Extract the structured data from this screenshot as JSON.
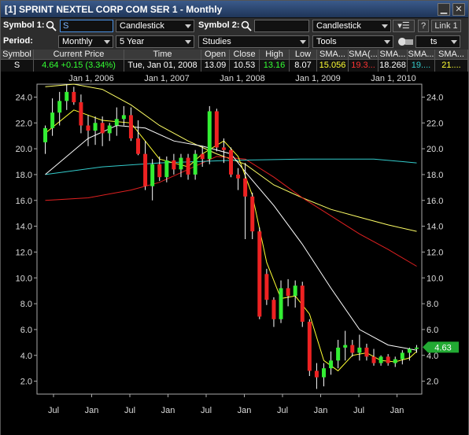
{
  "window": {
    "title": "[1] SPRINT NEXTEL CORP COM SER 1 - Monthly"
  },
  "toolbar": {
    "symbol1_label": "Symbol 1:",
    "symbol1_value": "S",
    "chart_type1": "Candlestick",
    "symbol2_label": "Symbol 2:",
    "symbol2_value": "",
    "chart_type2": "Candlestick",
    "help_label": "?",
    "link_label": "Link 1",
    "period_label": "Period:",
    "period_value": "Monthly",
    "range_value": "5 Year",
    "studies_value": "Studies",
    "tools_value": "Tools",
    "alerts_value": "ts"
  },
  "quote_table": {
    "headers": [
      "Symbol",
      "Current Price",
      "Time",
      "Open",
      "Close",
      "High",
      "Low",
      "SMA...",
      "SMA(...",
      "SMA...",
      "SMA...",
      "SMA..."
    ],
    "row": {
      "symbol": "S",
      "current_price": "4.64 +0.15 (3.34%)",
      "time": "Tue, Jan 01, 2008",
      "open": "13.09",
      "close": "10.53",
      "high": "13.16",
      "low": "8.07",
      "sma1": "15.056",
      "sma2": "19.3...",
      "sma3": "18.268",
      "sma4": "19....",
      "sma5": "21...."
    },
    "colors": {
      "price": "#33ff33",
      "high": "#33ff33",
      "sma1": "#ffff33",
      "sma2": "#ff3333",
      "sma3": "#ffffff",
      "sma4": "#33cccc",
      "sma5": "#ffff33"
    }
  },
  "chart_data": {
    "type": "candlestick",
    "title": "",
    "top_axis_labels": [
      "Jan 1, 2006",
      "Jan 1, 2007",
      "Jan 1, 2008",
      "Jan 1, 2009",
      "Jan 1, 2010"
    ],
    "bottom_axis_labels": [
      "Jul",
      "Jan",
      "Jul",
      "Jan",
      "Jul",
      "Jan",
      "Jul",
      "Jan",
      "Jul",
      "Jan"
    ],
    "y_ticks": [
      2.0,
      4.0,
      6.0,
      8.0,
      10.0,
      12.0,
      14.0,
      16.0,
      18.0,
      20.0,
      22.0,
      24.0
    ],
    "ylim": [
      1.0,
      25.0
    ],
    "current_price_label": "4.63",
    "candles": [
      [
        20.5,
        21.8,
        19.6,
        21.6
      ],
      [
        21.6,
        23.9,
        21.0,
        22.8
      ],
      [
        22.8,
        24.4,
        21.8,
        23.7
      ],
      [
        23.7,
        25.0,
        23.0,
        24.4
      ],
      [
        24.4,
        24.8,
        23.4,
        23.6
      ],
      [
        23.6,
        24.2,
        21.2,
        21.8
      ],
      [
        21.8,
        22.6,
        20.2,
        21.4
      ],
      [
        21.4,
        22.5,
        20.3,
        22.0
      ],
      [
        22.0,
        22.5,
        20.2,
        21.2
      ],
      [
        21.2,
        22.0,
        20.6,
        21.8
      ],
      [
        21.8,
        23.2,
        21.0,
        22.3
      ],
      [
        22.3,
        23.3,
        21.8,
        22.6
      ],
      [
        22.6,
        23.2,
        20.6,
        20.8
      ],
      [
        20.8,
        22.2,
        19.5,
        19.6
      ],
      [
        19.6,
        20.6,
        16.8,
        17.1
      ],
      [
        17.1,
        19.2,
        16.0,
        18.8
      ],
      [
        18.8,
        19.4,
        17.5,
        17.8
      ],
      [
        17.8,
        19.4,
        17.4,
        19.1
      ],
      [
        19.1,
        19.6,
        18.0,
        18.4
      ],
      [
        18.4,
        19.6,
        17.8,
        19.3
      ],
      [
        19.3,
        19.6,
        17.6,
        18.0
      ],
      [
        18.0,
        19.9,
        17.6,
        19.6
      ],
      [
        19.6,
        20.2,
        18.6,
        19.2
      ],
      [
        19.2,
        23.3,
        18.8,
        22.9
      ],
      [
        22.9,
        23.1,
        19.8,
        20.1
      ],
      [
        20.1,
        20.8,
        18.9,
        19.9
      ],
      [
        19.9,
        20.1,
        17.8,
        18.0
      ],
      [
        18.0,
        18.5,
        16.8,
        17.7
      ],
      [
        17.7,
        18.9,
        13.0,
        16.3
      ],
      [
        16.3,
        16.6,
        13.0,
        13.6
      ],
      [
        13.6,
        13.9,
        6.8,
        7.0
      ],
      [
        10.3,
        10.7,
        7.9,
        8.3
      ],
      [
        8.3,
        8.5,
        6.2,
        6.8
      ],
      [
        6.8,
        9.8,
        6.5,
        9.2
      ],
      [
        9.2,
        9.9,
        7.8,
        8.6
      ],
      [
        8.6,
        9.8,
        7.7,
        9.4
      ],
      [
        9.4,
        9.7,
        6.2,
        6.6
      ],
      [
        6.6,
        6.8,
        2.4,
        2.8
      ],
      [
        2.8,
        3.4,
        1.4,
        2.3
      ],
      [
        2.3,
        3.4,
        1.6,
        3.0
      ],
      [
        3.0,
        4.3,
        2.5,
        3.6
      ],
      [
        3.6,
        5.2,
        3.0,
        4.6
      ],
      [
        4.6,
        5.9,
        3.6,
        4.8
      ],
      [
        4.8,
        5.2,
        3.9,
        4.2
      ],
      [
        4.2,
        5.6,
        3.6,
        4.6
      ],
      [
        4.6,
        4.9,
        3.6,
        3.9
      ],
      [
        3.9,
        4.5,
        3.2,
        3.4
      ],
      [
        3.4,
        4.0,
        3.2,
        3.9
      ],
      [
        3.9,
        4.1,
        3.2,
        3.4
      ],
      [
        3.4,
        3.9,
        3.1,
        3.7
      ],
      [
        3.7,
        4.4,
        3.3,
        4.2
      ],
      [
        4.2,
        4.6,
        3.6,
        4.5
      ],
      [
        4.5,
        4.8,
        4.2,
        4.6
      ]
    ],
    "series": [
      {
        "color": "#ffff66",
        "points": [
          [
            0,
            24.8
          ],
          [
            4,
            25.0
          ],
          [
            8,
            24.6
          ],
          [
            12,
            23.4
          ],
          [
            16,
            21.8
          ],
          [
            20,
            20.6
          ],
          [
            24,
            19.6
          ],
          [
            28,
            18.8
          ],
          [
            32,
            17.2
          ],
          [
            36,
            16.2
          ],
          [
            40,
            15.3
          ],
          [
            44,
            14.7
          ],
          [
            48,
            14.1
          ],
          [
            52,
            13.6
          ]
        ]
      },
      {
        "color": "#e02020",
        "points": [
          [
            0,
            16.0
          ],
          [
            6,
            16.2
          ],
          [
            12,
            16.8
          ],
          [
            16,
            17.4
          ],
          [
            20,
            18.4
          ],
          [
            24,
            19.4
          ],
          [
            28,
            19.2
          ],
          [
            32,
            17.8
          ],
          [
            36,
            16.2
          ],
          [
            40,
            14.8
          ],
          [
            44,
            13.4
          ],
          [
            48,
            12.2
          ],
          [
            52,
            10.9
          ]
        ]
      },
      {
        "color": "#33cccc",
        "points": [
          [
            0,
            18.0
          ],
          [
            8,
            18.6
          ],
          [
            16,
            18.9
          ],
          [
            26,
            19.1
          ],
          [
            36,
            19.2
          ],
          [
            46,
            19.2
          ],
          [
            52,
            18.9
          ]
        ]
      },
      {
        "color": "#ffffff",
        "points": [
          [
            0,
            18.0
          ],
          [
            6,
            20.8
          ],
          [
            10,
            21.8
          ],
          [
            14,
            21.6
          ],
          [
            18,
            20.6
          ],
          [
            22,
            20.2
          ],
          [
            26,
            19.6
          ],
          [
            28,
            18.2
          ],
          [
            32,
            15.6
          ],
          [
            36,
            12.6
          ],
          [
            40,
            9.2
          ],
          [
            44,
            6.0
          ],
          [
            48,
            4.8
          ],
          [
            52,
            4.4
          ]
        ]
      },
      {
        "color": "#ffff33",
        "points": [
          [
            0,
            21.2
          ],
          [
            4,
            23.0
          ],
          [
            8,
            22.2
          ],
          [
            12,
            22.0
          ],
          [
            16,
            19.2
          ],
          [
            20,
            18.6
          ],
          [
            22,
            19.6
          ],
          [
            25,
            20.6
          ],
          [
            27,
            19.4
          ],
          [
            29,
            16.4
          ],
          [
            31,
            11.2
          ],
          [
            33,
            8.4
          ],
          [
            35,
            8.6
          ],
          [
            37,
            7.2
          ],
          [
            39,
            3.6
          ],
          [
            41,
            2.8
          ],
          [
            43,
            4.0
          ],
          [
            45,
            4.2
          ],
          [
            47,
            3.6
          ],
          [
            49,
            3.5
          ],
          [
            51,
            3.8
          ],
          [
            52,
            4.3
          ]
        ]
      }
    ]
  }
}
